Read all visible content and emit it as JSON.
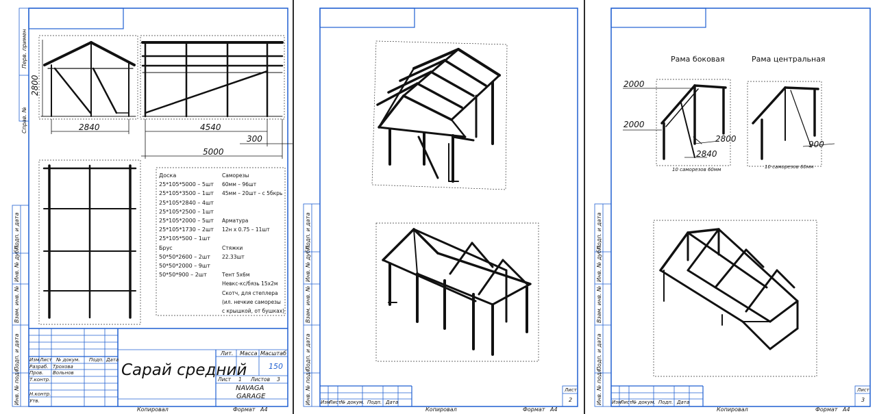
{
  "sheet1": {
    "side_labels": [
      "Перв. примен",
      "Справ. №",
      "Подп. и дата",
      "Инв. № дубл.",
      "Взам. инв. №",
      "Подп. и дата",
      "Инв. № подл."
    ],
    "dims": {
      "h_2800": "2800",
      "w_2840": "2840",
      "w_4540": "4540",
      "w_300": "300",
      "w_5000": "5000"
    },
    "spec_left": [
      "Доска",
      "25*105*5000 – 5шт",
      "25*105*3500 – 1шт",
      "25*105*2840 – 4шт",
      "25*105*2500 – 1шт",
      "25*105*2000 – 5шт",
      "25*105*1730 – 2шт",
      "25*105*500 – 1шт",
      "Брус",
      "50*50*2600 – 2шт",
      "50*50*2000 – 9шт",
      "50*50*900 – 2шт"
    ],
    "spec_right": [
      "Саморезы",
      "60мм – 96шт",
      "45мм – 20шт – с 5бкрь",
      "",
      "",
      "Арматура",
      "12н х 0.75 – 11шт",
      "",
      "Стяжки",
      "22.33шт",
      "",
      "Тент 5х6м",
      "Невкс-кс/бязь 15х2м",
      "Скотч, для степлера",
      "(ил. нечкие саморезы",
      "с крышкой, от бушках)"
    ],
    "title_block": {
      "col_headers": [
        "Изм",
        "Лист",
        "№ докум.",
        "Подп.",
        "Дата"
      ],
      "roles": [
        "Разраб.",
        "Пров.",
        "Т.контр.",
        "",
        "Н.контр.",
        "Утв."
      ],
      "names": [
        "Трохова",
        "Вольнов",
        "",
        "",
        "",
        ""
      ],
      "title": "Сарай средний",
      "lit_label": "Лит.",
      "mass_label": "Масса",
      "scale_label": "Масштаб",
      "scale_value": "150",
      "sheet_label": "Лист",
      "sheet_value": "1",
      "sheets_label": "Листов",
      "sheets_value": "3",
      "org_line1": "NAVAGA",
      "org_line2": "GARAGE"
    },
    "footer_copied": "Копировал",
    "footer_format": "Формат",
    "footer_format_value": "А4"
  },
  "sheet2": {
    "side_labels": [
      "Подп. и дата",
      "Инв. № дубл.",
      "Взам. инв. №",
      "Подп. и дата",
      "Инв. № подл."
    ],
    "col_headers": [
      "Изм",
      "Лист",
      "№ докум.",
      "Подп.",
      "Дата"
    ],
    "sheet_label": "Лист",
    "sheet_value": "2",
    "footer_copied": "Копировал",
    "footer_format": "Формат",
    "footer_format_value": "А4"
  },
  "sheet3": {
    "side_labels": [
      "Подп. и дата",
      "Инв. № дубл.",
      "Взам. инв. №",
      "Подп. и дата",
      "Инв. № подл."
    ],
    "caption_side": "Рама боковая",
    "caption_center": "Рама центральная",
    "dims": {
      "d_2000a": "2000",
      "d_2000b": "2000",
      "d_2800": "2800",
      "d_2840": "2840",
      "d_900": "900"
    },
    "note_left": "10 саморезов 60мм",
    "note_right": "10 саморезов 60мм",
    "col_headers": [
      "Изм",
      "Лист",
      "№ докум.",
      "Подп.",
      "Дата"
    ],
    "sheet_label": "Лист",
    "sheet_value": "3",
    "footer_copied": "Копировал",
    "footer_format": "Формат",
    "footer_format_value": "А4"
  },
  "colors": {
    "frame": "#1f5fd1",
    "ink": "#111111"
  }
}
